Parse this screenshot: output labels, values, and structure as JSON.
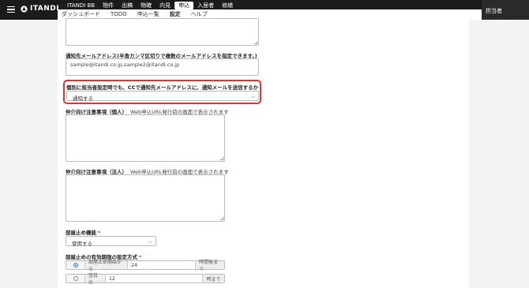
{
  "header": {
    "logo_text": "ITANDI",
    "top_nav": [
      "ITANDI BB",
      "物件",
      "出稿",
      "物確",
      "内見",
      "申込",
      "入居者",
      "修繕"
    ],
    "active_top": "申込",
    "sub_nav": [
      "ダッシュボード",
      "TODO",
      "申込一覧",
      "設定",
      "ヘルプ"
    ],
    "active_sub": "設定",
    "user_label": "担当者"
  },
  "form": {
    "notify_email": {
      "label": "通知先メールアドレス(半角カンマ区切りで複数のメールアドレスを指定できます。)",
      "value": "sample@itandi.co.jp,sample2@itandi.co.jp"
    },
    "cc_notify": {
      "label": "個別に担当者設定時でも、CCで通知先メールアドレスに、通知メールを送信するか",
      "selected": "通知する"
    },
    "broker_notes_individual": {
      "label": "仲介向け注意事項（個人）",
      "hint": "Web申込URL発行前の画面で表示されます",
      "value": ""
    },
    "broker_notes_corporate": {
      "label": "仲介向け注意事項（法人）",
      "hint": "Web申込URL発行前の画面で表示されます",
      "value": ""
    },
    "room_hold": {
      "label": "部屋止め機能",
      "required_mark": "*",
      "selected": "使用する"
    },
    "room_hold_period": {
      "label": "部屋止めの有効期限の設定方式",
      "required_mark": "*",
      "option1": {
        "prefix": "部屋止め開始から",
        "value": "24",
        "suffix": "時間後まで",
        "checked": true
      },
      "option2": {
        "prefix": "翌日の",
        "value": "12",
        "suffix": "時まで",
        "checked": false
      }
    }
  },
  "colors": {
    "topbar": "#1b1b1b",
    "highlight": "#e0342c",
    "required": "#d33333"
  }
}
